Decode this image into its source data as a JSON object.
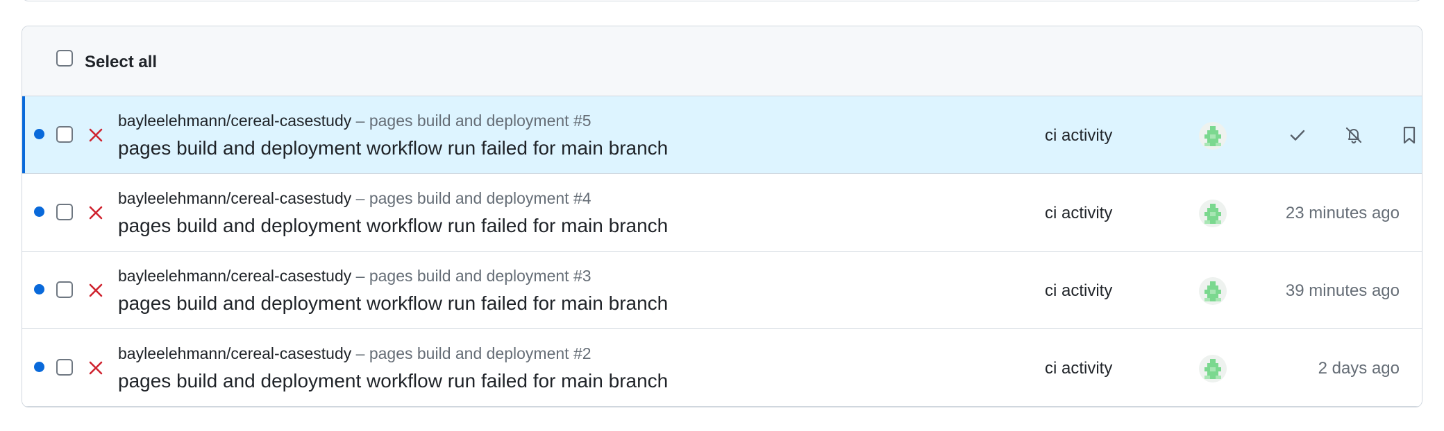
{
  "header": {
    "select_all_label": "Select all"
  },
  "notifications": [
    {
      "repo": "bayleelehmann/cereal-casestudy",
      "workflow": "– pages build and deployment #5",
      "title": "pages build and deployment workflow run failed for main branch",
      "reason": "ci activity",
      "time": "",
      "selected": true,
      "unread": true,
      "status_icon": "x-icon",
      "actions": [
        "check-icon",
        "bell-slash-icon",
        "bookmark-icon"
      ]
    },
    {
      "repo": "bayleelehmann/cereal-casestudy",
      "workflow": "– pages build and deployment #4",
      "title": "pages build and deployment workflow run failed for main branch",
      "reason": "ci activity",
      "time": "23 minutes ago",
      "selected": false,
      "unread": true,
      "status_icon": "x-icon"
    },
    {
      "repo": "bayleelehmann/cereal-casestudy",
      "workflow": "– pages build and deployment #3",
      "title": "pages build and deployment workflow run failed for main branch",
      "reason": "ci activity",
      "time": "39 minutes ago",
      "selected": false,
      "unread": true,
      "status_icon": "x-icon"
    },
    {
      "repo": "bayleelehmann/cereal-casestudy",
      "workflow": "– pages build and deployment #2",
      "title": "pages build and deployment workflow run failed for main branch",
      "reason": "ci activity",
      "time": "2 days ago",
      "selected": false,
      "unread": true,
      "status_icon": "x-icon"
    }
  ],
  "colors": {
    "unread_dot": "#0969da",
    "failed_icon": "#cf222e",
    "selected_row": "#ddf4ff",
    "avatar_identicon": "#7bd88f"
  }
}
